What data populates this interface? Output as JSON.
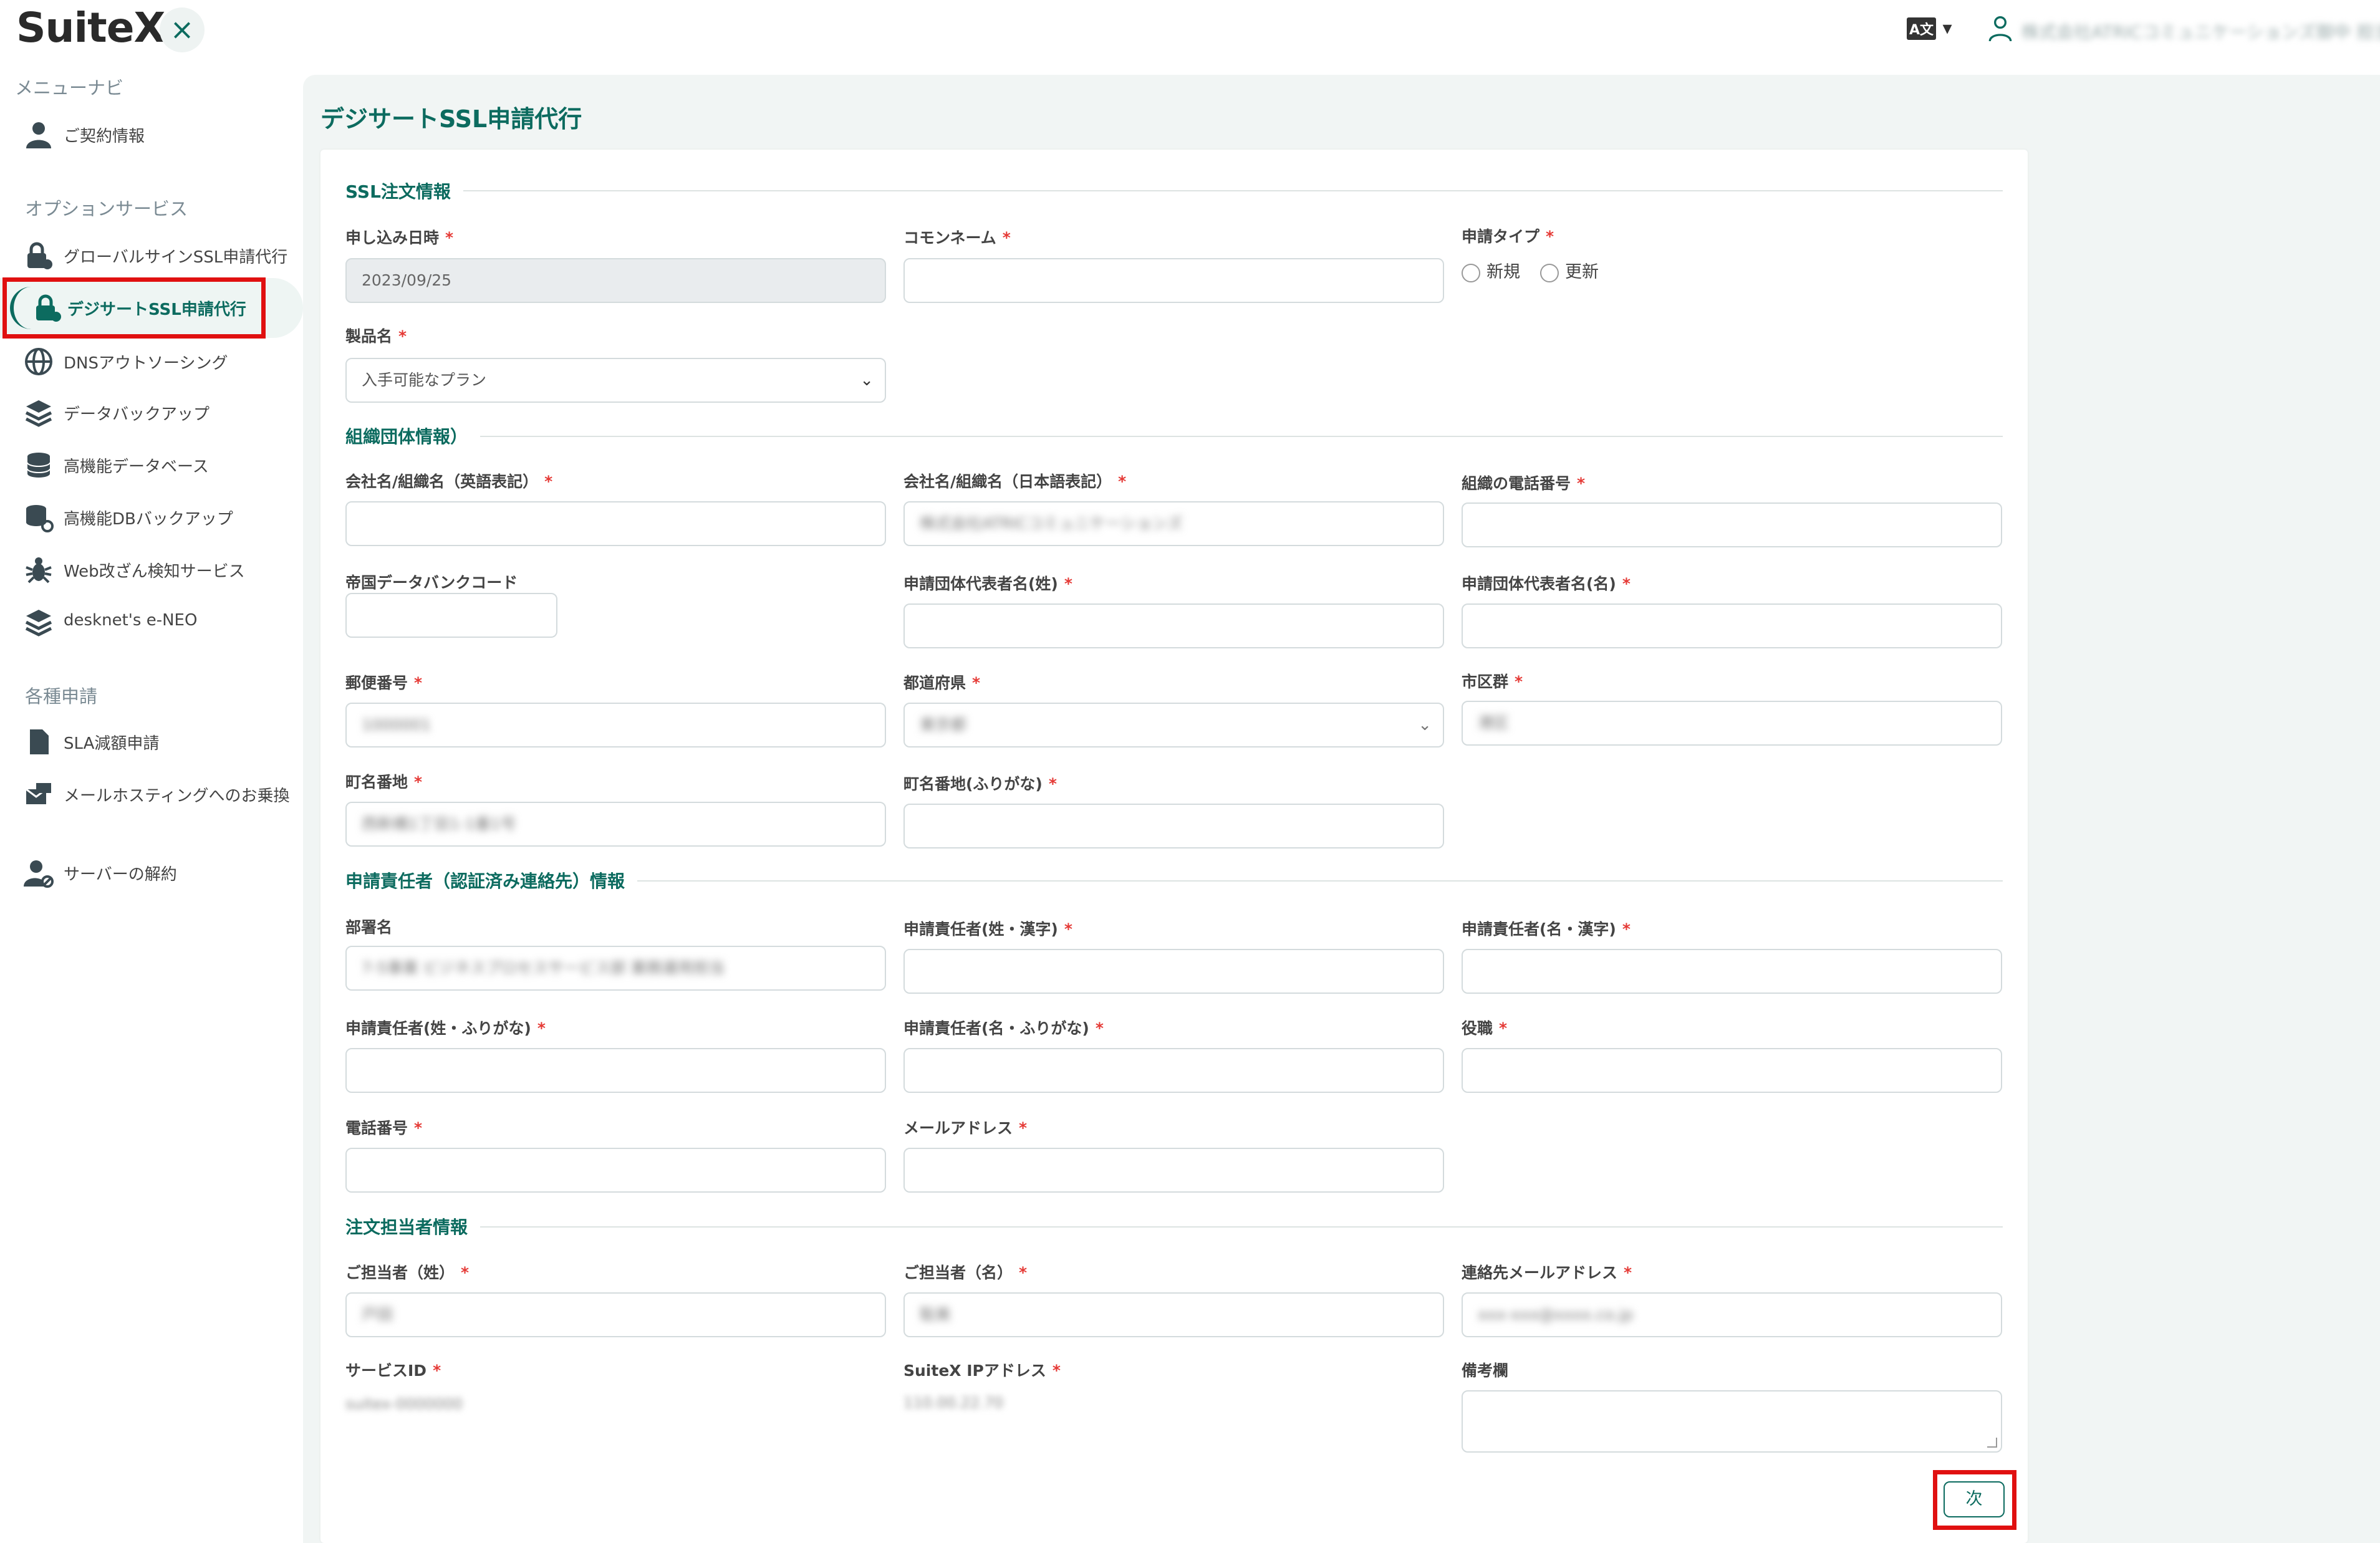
{
  "app": {
    "logo": "SuiteX",
    "close_icon": "×"
  },
  "header": {
    "lang_badge": "A文",
    "lang_caret": "▾",
    "account_name": "株式会社ATRICコミュニケーションズ御中 担当"
  },
  "sidebar": {
    "heading_menu": "メニューナビ",
    "contract": "ご契約情報",
    "heading_options": "オプションサービス",
    "items": [
      {
        "label": "グローバルサインSSL申請代行",
        "icon": "lock-gear-icon"
      },
      {
        "label": "デジサートSSL申請代行",
        "icon": "lock-gear-icon",
        "active": true
      },
      {
        "label": "DNSアウトソーシング",
        "icon": "globe-icon"
      },
      {
        "label": "データバックアップ",
        "icon": "layers-icon"
      },
      {
        "label": "高機能データベース",
        "icon": "database-icon"
      },
      {
        "label": "高機能DBバックアップ",
        "icon": "database-restore-icon"
      },
      {
        "label": "Web改ざん検知サービス",
        "icon": "bug-icon"
      },
      {
        "label": "desknet's e-NEO",
        "icon": "layers-icon"
      }
    ],
    "heading_requests": "各種申請",
    "requests": [
      {
        "label": "SLA減額申請",
        "icon": "file-icon"
      },
      {
        "label": "メールホスティングへのお乗換",
        "icon": "mail-transfer-icon"
      }
    ],
    "cancel": "サーバーの解約"
  },
  "page": {
    "title": "デジサートSSL申請代行"
  },
  "form": {
    "required_mark": "*",
    "sections": {
      "ssl": "SSL注文情報",
      "org": "組織団体情報）",
      "applicant": "申請責任者（認証済み連絡先）情報",
      "order_contact": "注文担当者情報"
    },
    "ssl": {
      "apply_date_label": "申し込み日時",
      "apply_date_value": "2023/09/25",
      "common_name_label": "コモンネーム",
      "common_name_value": "",
      "type_label": "申請タイプ",
      "type_new": "新規",
      "type_renew": "更新",
      "product_label": "製品名",
      "product_value": "入手可能なプラン"
    },
    "org": {
      "name_en_label": "会社名/組織名（英語表記）",
      "name_en_value": "",
      "name_ja_label": "会社名/組織名（日本語表記）",
      "name_ja_value": "株式会社ATRICコミュニケーションズ",
      "phone_label": "組織の電話番号",
      "phone_value": "",
      "tdb_label": "帝国データバンクコード",
      "tdb_value": "",
      "rep_last_label": "申請団体代表者名(姓)",
      "rep_last_value": "",
      "rep_first_label": "申請団体代表者名(名)",
      "rep_first_value": "",
      "zip_label": "郵便番号",
      "zip_value": "1000001",
      "pref_label": "都道府県",
      "pref_value": "東京都",
      "city_label": "市区群",
      "city_value": "港区",
      "street_label": "町名番地",
      "street_value": "西新橋1丁目1-1番1号",
      "street_kana_label": "町名番地(ふりがな)",
      "street_kana_value": ""
    },
    "applicant": {
      "dept_label": "部署名",
      "dept_value": "7-5事業 ビジネスプロセスサービス部 業務運用担当",
      "last_kanji_label": "申請責任者(姓・漢字)",
      "first_kanji_label": "申請責任者(名・漢字)",
      "last_kana_label": "申請責任者(姓・ふりがな)",
      "first_kana_label": "申請責任者(名・ふりがな)",
      "title_label": "役職",
      "phone_label": "電話番号",
      "email_label": "メールアドレス"
    },
    "order_contact": {
      "last_label": "ご担当者（姓）",
      "last_value": "戸田",
      "first_label": "ご担当者（名）",
      "first_value": "聡美",
      "email_label": "連絡先メールアドレス",
      "email_value": "xxx-xxx@xxxx.co.jp",
      "service_id_label": "サービスID",
      "service_id_value": "suitex-0000000",
      "ip_label": "SuiteX IPアドレス",
      "ip_value": "110.00.22.70",
      "remarks_label": "備考欄"
    },
    "next_button": "次"
  }
}
